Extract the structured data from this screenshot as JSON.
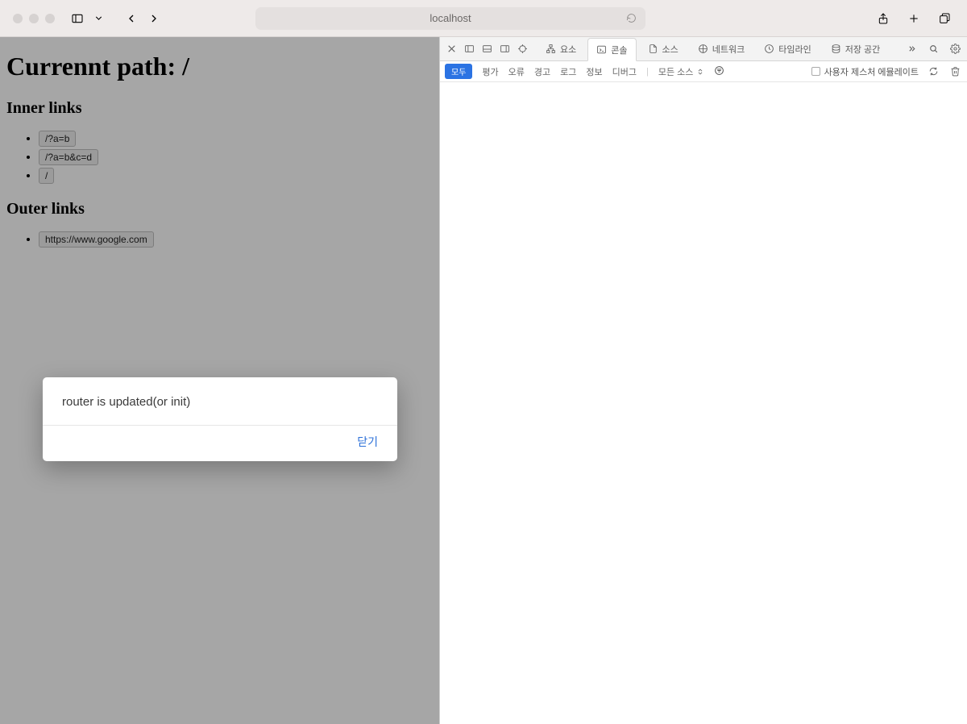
{
  "chrome": {
    "address": "localhost"
  },
  "page": {
    "title": "Currennt path: /",
    "inner_heading": "Inner links",
    "outer_heading": "Outer links",
    "inner_links": [
      "/?a=b",
      "/?a=b&c=d",
      "/"
    ],
    "outer_links": [
      "https://www.google.com"
    ]
  },
  "alert": {
    "message": "router is updated(or init)",
    "close_label": "닫기"
  },
  "devtools": {
    "tabs": {
      "elements": "요소",
      "console": "콘솔",
      "sources": "소스",
      "network": "네트워크",
      "timeline": "타임라인",
      "storage": "저장 공간"
    },
    "filters": {
      "all": "모두",
      "eval": "평가",
      "error": "오류",
      "warn": "경고",
      "log": "로그",
      "info": "정보",
      "debug": "디버그",
      "all_sources": "모든 소스"
    },
    "emulate_gesture": "사용자 제스처 에뮬레이트"
  }
}
